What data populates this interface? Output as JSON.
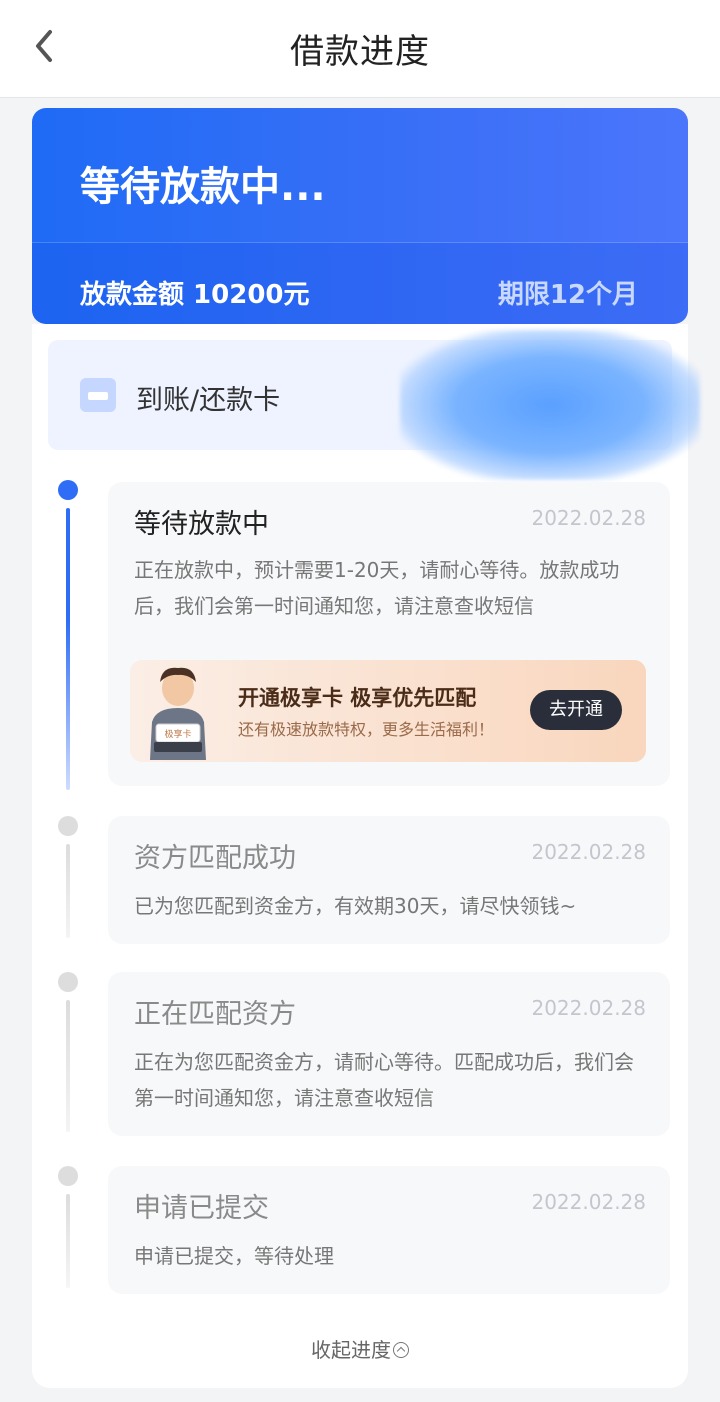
{
  "header": {
    "title": "借款进度"
  },
  "status": {
    "headline": "等待放款中...",
    "amount_label": "放款金额 10200元",
    "term_label": "期限12个月"
  },
  "card": {
    "label": "到账/还款卡"
  },
  "steps": [
    {
      "title": "等待放款中",
      "date": "2022.02.28",
      "desc": "正在放款中，预计需要1-20天，请耐心等待。放款成功后，我们会第一时间通知您，请注意查收短信",
      "active": true
    },
    {
      "title": "资方匹配成功",
      "date": "2022.02.28",
      "desc": "已为您匹配到资金方，有效期30天，请尽快领钱~",
      "active": false
    },
    {
      "title": "正在匹配资方",
      "date": "2022.02.28",
      "desc": "正在为您匹配资金方，请耐心等待。匹配成功后，我们会第一时间通知您，请注意查收短信",
      "active": false
    },
    {
      "title": "申请已提交",
      "date": "2022.02.28",
      "desc": "申请已提交，等待处理",
      "active": false
    }
  ],
  "promo": {
    "badge": "极享卡",
    "title": "开通极享卡 极享优先匹配",
    "subtitle": "还有极速放款特权，更多生活福利！",
    "button": "去开通"
  },
  "footer": {
    "collapse_label": "收起进度"
  },
  "colors": {
    "accent": "#2f6df6",
    "active_dot": "#2f6df6",
    "inactive_dot": "#dddddd"
  }
}
